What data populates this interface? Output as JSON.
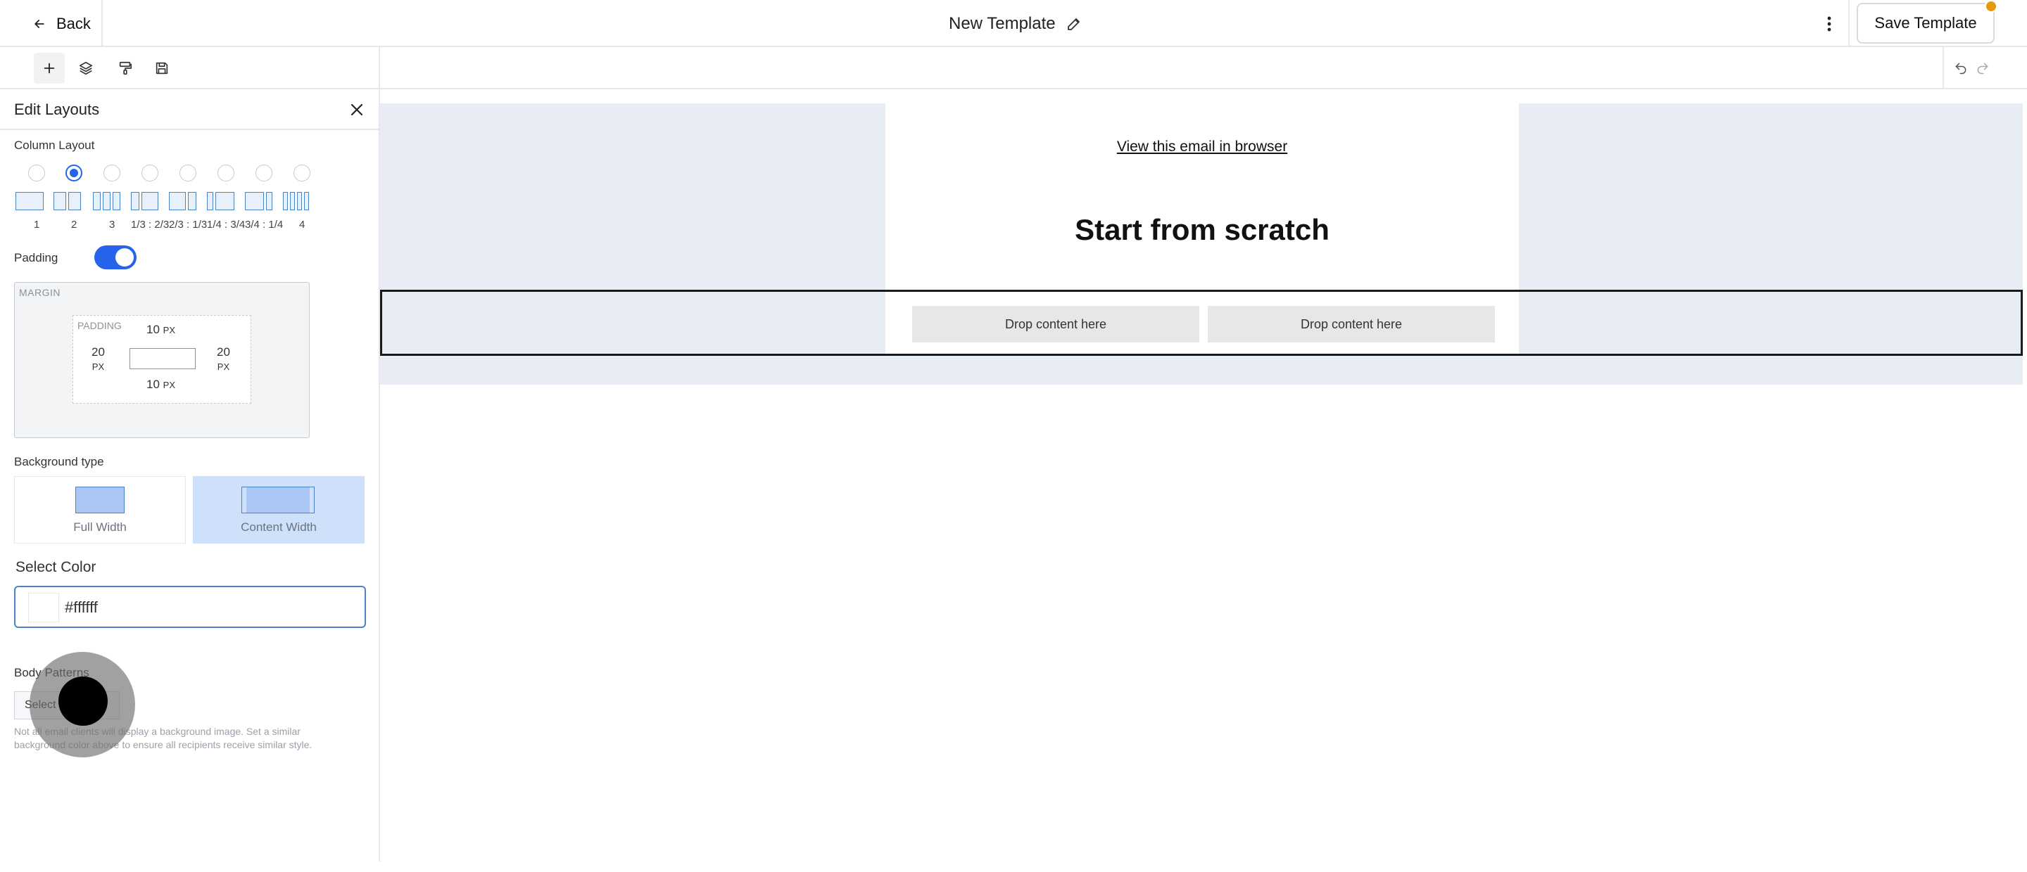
{
  "header": {
    "back_label": "Back",
    "title": "New Template",
    "save_label": "Save Template"
  },
  "panel": {
    "title": "Edit Layouts",
    "column_layout_label": "Column Layout",
    "column_options": [
      "1",
      "2",
      "3",
      "1/3 : 2/3",
      "2/3 : 1/3",
      "1/4 : 3/4",
      "3/4 : 1/4",
      "4"
    ],
    "selected_column_option": "2",
    "padding_label": "Padding",
    "padding_enabled": true,
    "margin_label": "MARGIN",
    "padding_box_label": "PADDING",
    "padding_top": "10",
    "padding_bottom": "10",
    "padding_left": "20",
    "padding_right": "20",
    "unit": "PX",
    "background_type_label": "Background type",
    "bg_full_width": "Full Width",
    "bg_content_width": "Content Width",
    "selected_bg_type": "Content Width",
    "select_color_label": "Select Color",
    "color_value": "#ffffff",
    "body_patterns_label": "Body Patterns",
    "pattern_button": "Select Pattern",
    "hint": "Not all email clients will display a background image. Set a similar background color above to ensure all recipients receive similar style."
  },
  "canvas": {
    "view_link": "View this email in browser",
    "headline": "Start from scratch",
    "drop_1": "Drop content here",
    "drop_2": "Drop content here"
  },
  "colors": {
    "accent": "#2563eb",
    "canvas_bg": "#e8edf5",
    "notif": "#e49b0f"
  }
}
